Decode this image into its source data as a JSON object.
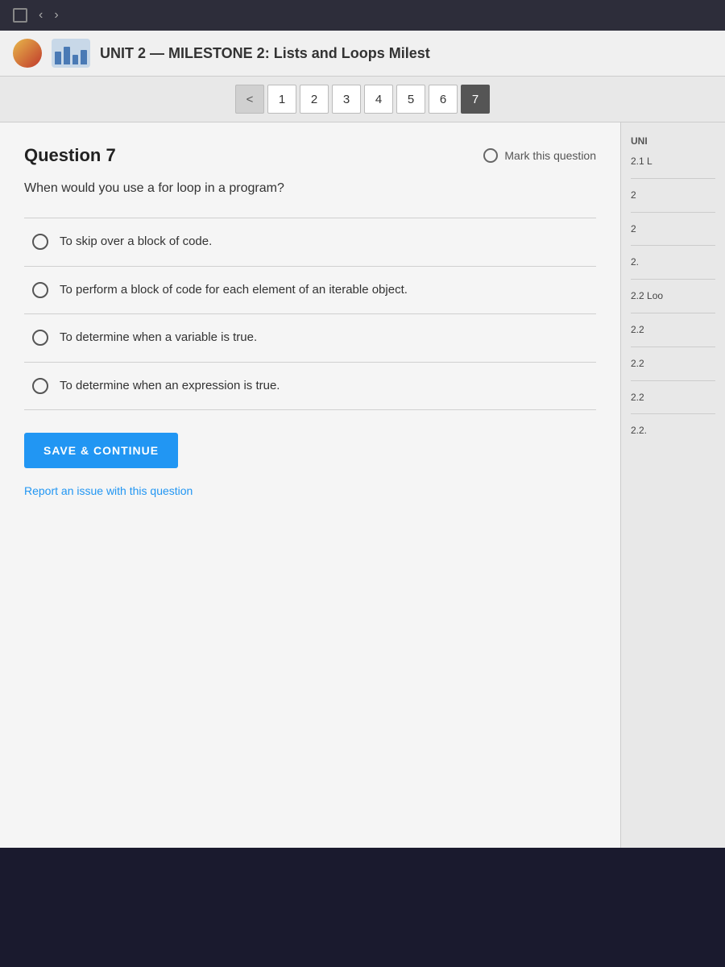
{
  "browser": {
    "nav_back": "‹",
    "nav_forward": "›",
    "window_icon": "□"
  },
  "header": {
    "title": "UNIT 2 — MILESTONE 2: Lists and Loops Milest",
    "logo_alt": "Sophia Learning"
  },
  "pagination": {
    "current_page": 7,
    "pages": [
      "1",
      "2",
      "3",
      "4",
      "5",
      "6",
      "7"
    ],
    "nav_prev": "<"
  },
  "question": {
    "label": "Question 7",
    "mark_label": "Mark this question",
    "question_text": "When would you use a for loop in a program?",
    "options": [
      {
        "id": "a",
        "text": "To skip over a block of code."
      },
      {
        "id": "b",
        "text": "To perform a block of code for each element of an iterable object."
      },
      {
        "id": "c",
        "text": "To determine when a variable is true."
      },
      {
        "id": "d",
        "text": "To determine when an expression is true."
      }
    ],
    "save_continue_label": "SAVE & CONTINUE",
    "report_label": "Report an issue with this question"
  },
  "sidebar": {
    "section1_title": "UNI",
    "items": [
      {
        "label": "2.1 L"
      },
      {
        "label": "2"
      },
      {
        "label": "2"
      },
      {
        "label": "2."
      },
      {
        "label": "2.2 Loo"
      },
      {
        "label": "2.2"
      },
      {
        "label": "2.2"
      },
      {
        "label": "2.2"
      },
      {
        "label": "2.2."
      }
    ]
  },
  "colors": {
    "accent_blue": "#2196f3",
    "header_bg": "#f0f0f0",
    "question_bg": "#f5f5f5"
  }
}
